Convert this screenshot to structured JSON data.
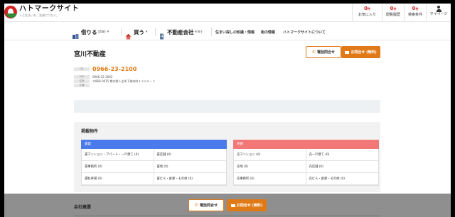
{
  "site": {
    "name": "ハトマークサイト",
    "tagline": "人と住まいを、笑顔でつなぐ。"
  },
  "header": {
    "favorites": {
      "count": "0",
      "unit": "件",
      "label": "お気に入り"
    },
    "history": {
      "count": "0",
      "unit": "件",
      "label": "閲覧履歴"
    },
    "conditions": {
      "count": "0",
      "unit": "件",
      "label": "検索条件"
    },
    "mypage": {
      "label": "マイページ"
    }
  },
  "nav": {
    "rent": {
      "label": "借りる",
      "sub": "(賃貸)"
    },
    "buy": {
      "label": "買う"
    },
    "company": {
      "label": "不動産会社",
      "sub": "を探す"
    },
    "links": [
      "住まい探しの知識・情報",
      "街の情報",
      "ハトマークサイトについて"
    ]
  },
  "company": {
    "name": "宮川不動産",
    "tel_label": "TEL",
    "tel": "0966-23-2100",
    "fax_label": "FAX",
    "fax": "0966-22-3092",
    "address_label": "住所",
    "address": "〒868-0015 熊本県人吉市下城本町１６６０－１",
    "access_label": "交通",
    "access": ""
  },
  "buttons": {
    "tel": "電話問合せ",
    "mail": "お問合せ (無料)"
  },
  "listings": {
    "title": "掲載物件",
    "rent": {
      "label": "賃貸",
      "color": "#4a7bea",
      "items": [
        "賃マンション・アパート・一戸建て (0)",
        "賃店舗 (0)",
        "賃事務所 (0)",
        "賃地 (0)",
        "賃駐車場 (0)",
        "賃ビル・倉庫・その他 (0)"
      ]
    },
    "sale": {
      "label": "売買",
      "color": "#f27878",
      "items": [
        "売マンション (0)",
        "売一戸建て (0)",
        "売地 (0)",
        "売店舗 (0)",
        "売事務所 (0)",
        "売ビル・倉庫・その他 (0)"
      ]
    }
  },
  "overview": {
    "title": "会社概要"
  },
  "colors": {
    "brand_red": "#d32222",
    "accent_orange": "#e07a17"
  }
}
